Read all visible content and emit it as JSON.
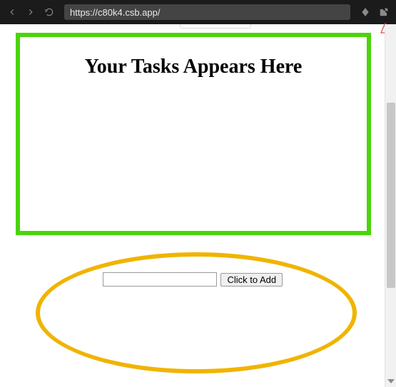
{
  "chrome": {
    "url": "https://c80k4.csb.app/"
  },
  "page": {
    "heading": "Your Tasks Appears Here",
    "task_input_value": "",
    "add_button_label": "Click to Add"
  }
}
